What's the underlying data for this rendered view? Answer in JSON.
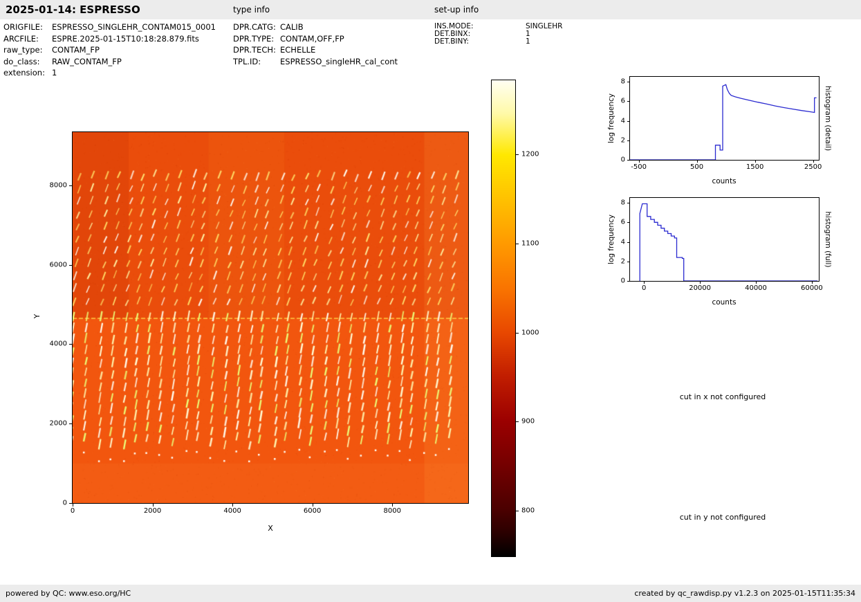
{
  "header": {
    "title": "2025-01-14: ESPRESSO",
    "type_info": "type info",
    "setup_info": "set-up info"
  },
  "metadata": {
    "left": [
      {
        "label": "ORIGFILE:",
        "value": "ESPRESSO_SINGLEHR_CONTAM015_0001"
      },
      {
        "label": "ARCFILE:",
        "value": "ESPRE.2025-01-15T10:18:28.879.fits"
      },
      {
        "label": "raw_type:",
        "value": "CONTAM_FP"
      },
      {
        "label": "do_class:",
        "value": "RAW_CONTAM_FP"
      },
      {
        "label": "extension:",
        "value": "1"
      }
    ],
    "middle": [
      {
        "label": "DPR.CATG:",
        "value": "CALIB"
      },
      {
        "label": "DPR.TYPE:",
        "value": "CONTAM,OFF,FP"
      },
      {
        "label": "DPR.TECH:",
        "value": "ECHELLE"
      },
      {
        "label": "TPL.ID:",
        "value": "ESPRESSO_singleHR_cal_cont"
      }
    ],
    "right": [
      {
        "label": "INS.MODE:",
        "value": "SINGLEHR"
      },
      {
        "label": "DET.BINX:",
        "value": "1"
      },
      {
        "label": "DET.BINY:",
        "value": "1"
      }
    ]
  },
  "messages": {
    "cut_x": "cut in x not configured",
    "cut_y": "cut in y not configured"
  },
  "footer": {
    "left": "powered by QC: www.eso.org/HC",
    "right": "created by qc_rawdisp.py v1.2.3 on 2025-01-15T11:35:34"
  },
  "chart_data": [
    {
      "type": "heatmap",
      "name": "raw-ccd-image",
      "xlabel": "X",
      "ylabel": "Y",
      "xlim": [
        0,
        9900
      ],
      "ylim": [
        0,
        9340
      ],
      "x_ticks": [
        0,
        2000,
        4000,
        6000,
        8000
      ],
      "y_ticks": [
        0,
        2000,
        4000,
        6000,
        8000
      ],
      "colormap": "hot",
      "background_level_counts": 1000,
      "description": "ESPRESSO raw CONTAM_FP echelle frame: orange background near 1000 counts, ~31 columns of bright dashed Fabry-Perot order stripes from y~8200 down to y~1000, upper detector half darker red, bright horizontal detector boundary at y~4650, brighter orange band at right edge",
      "render_hints": {
        "base_color": "#f2560e",
        "upper_tint": "rgba(200,40,0,0.18)",
        "left_upper_tint": "rgba(170,25,0,0.12)",
        "mid_band_tint": "rgba(255,150,40,0.10)",
        "right_band_tint": "rgba(255,160,60,0.16)",
        "bottom_tint": "rgba(255,150,70,0.10)",
        "boundary_line_color": "#ffe24e",
        "boundary_y": 4660,
        "stripe_count": 31,
        "stripe_top": 8230,
        "stripe_mid": 4700,
        "stripe_bottom": 1050
      }
    },
    {
      "type": "colorbar",
      "ticks": [
        1200,
        1100,
        1000,
        900,
        800
      ],
      "vmin": 748,
      "vmax": 1284,
      "colormap": "hot"
    },
    {
      "type": "line",
      "title": "histogram (detail)",
      "xlabel": "counts",
      "ylabel": "log frequency",
      "x_ticks": [
        -500,
        500,
        1500,
        2500
      ],
      "y_ticks": [
        0,
        2,
        4,
        6,
        8
      ],
      "xlim": [
        -650,
        2600
      ],
      "ylim": [
        0,
        8.5
      ],
      "line_color": "#2a2ad0",
      "points": [
        [
          -650,
          0
        ],
        [
          820,
          0
        ],
        [
          820,
          1.5
        ],
        [
          900,
          1.5
        ],
        [
          900,
          1.0
        ],
        [
          945,
          1.0
        ],
        [
          945,
          7.55
        ],
        [
          1000,
          7.7
        ],
        [
          1025,
          7.2
        ],
        [
          1060,
          6.8
        ],
        [
          1090,
          6.6
        ],
        [
          1160,
          6.45
        ],
        [
          1260,
          6.3
        ],
        [
          1400,
          6.1
        ],
        [
          1550,
          5.9
        ],
        [
          1700,
          5.72
        ],
        [
          1850,
          5.52
        ],
        [
          2000,
          5.35
        ],
        [
          2150,
          5.2
        ],
        [
          2300,
          5.05
        ],
        [
          2450,
          4.92
        ],
        [
          2525,
          4.85
        ],
        [
          2525,
          6.35
        ],
        [
          2560,
          6.35
        ]
      ]
    },
    {
      "type": "line",
      "title": "histogram (full)",
      "xlabel": "counts",
      "ylabel": "log frequency",
      "x_ticks": [
        0,
        20000,
        40000,
        60000
      ],
      "y_ticks": [
        0,
        2,
        4,
        6,
        8
      ],
      "xlim": [
        -5000,
        62500
      ],
      "ylim": [
        0,
        8.5
      ],
      "line_color": "#2a2ad0",
      "points": [
        [
          -1500,
          0
        ],
        [
          -1500,
          6.9
        ],
        [
          -600,
          7.9
        ],
        [
          1100,
          7.9
        ],
        [
          1100,
          6.6
        ],
        [
          2400,
          6.6
        ],
        [
          2400,
          6.3
        ],
        [
          3700,
          6.3
        ],
        [
          3700,
          6.0
        ],
        [
          4900,
          6.0
        ],
        [
          4900,
          5.7
        ],
        [
          6100,
          5.7
        ],
        [
          6100,
          5.4
        ],
        [
          7300,
          5.4
        ],
        [
          7300,
          5.1
        ],
        [
          8500,
          5.1
        ],
        [
          8500,
          4.85
        ],
        [
          9700,
          4.85
        ],
        [
          9700,
          4.6
        ],
        [
          10900,
          4.6
        ],
        [
          10900,
          4.4
        ],
        [
          11700,
          4.4
        ],
        [
          11700,
          2.4
        ],
        [
          13700,
          2.4
        ],
        [
          13700,
          2.3
        ],
        [
          14200,
          2.3
        ],
        [
          14200,
          0
        ],
        [
          62000,
          0
        ]
      ]
    }
  ]
}
